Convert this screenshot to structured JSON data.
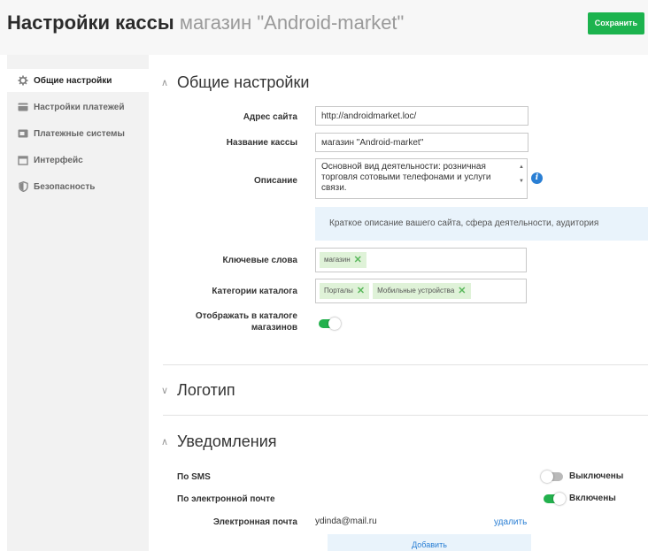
{
  "header": {
    "title": "Настройки кассы",
    "subtitle": "магазин \"Android-market\"",
    "save_label": "Сохранить"
  },
  "sidebar": {
    "items": [
      {
        "label": "Общие настройки",
        "icon": "gear-icon",
        "active": true
      },
      {
        "label": "Настройки платежей",
        "icon": "card-icon",
        "active": false
      },
      {
        "label": "Платежные системы",
        "icon": "payment-icon",
        "active": false
      },
      {
        "label": "Интерфейс",
        "icon": "window-icon",
        "active": false
      },
      {
        "label": "Безопасность",
        "icon": "shield-icon",
        "active": false
      }
    ]
  },
  "general": {
    "title": "Общие настройки",
    "site_address_label": "Адрес сайта",
    "site_address_value": "http://androidmarket.loc/",
    "cashbox_name_label": "Название кассы",
    "cashbox_name_value": "магазин \"Android-market\"",
    "description_label": "Описание",
    "description_value": "Основной вид деятельности: розничная торговля сотовыми телефонами и услуги связи.",
    "description_hint": "Краткое описание вашего сайта, сфера деятельности, аудитория",
    "keywords_label": "Ключевые слова",
    "keywords": [
      "магазин"
    ],
    "categories_label": "Категории каталога",
    "categories": [
      "Порталы",
      "Мобильные устройства"
    ],
    "show_in_catalog_label_1": "Отображать в каталоге",
    "show_in_catalog_label_2": "магазинов",
    "show_in_catalog": true
  },
  "logo": {
    "title": "Логотип"
  },
  "notifications": {
    "title": "Уведомления",
    "sms_label": "По SMS",
    "sms_state": "Выключены",
    "sms_enabled": false,
    "email_label": "По электронной почте",
    "email_state": "Включены",
    "email_enabled": true,
    "email_field_label": "Электронная почта",
    "email_value": "ydinda@mail.ru",
    "delete_label": "удалить",
    "add_label": "Добавить"
  },
  "colors": {
    "accent_green": "#1cb34e",
    "link_blue": "#2a7fd4",
    "tag_bg": "#dff2d8",
    "hint_bg": "#e9f3fb"
  }
}
